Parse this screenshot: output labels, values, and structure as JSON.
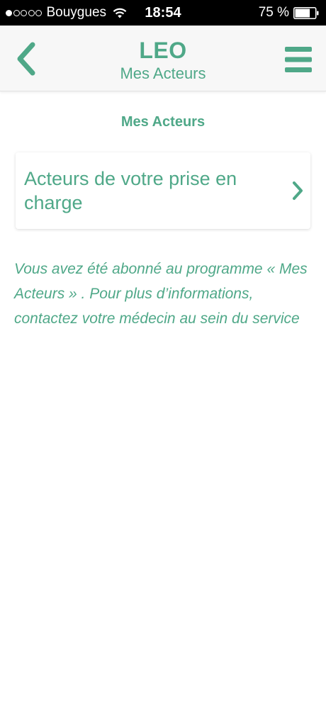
{
  "status_bar": {
    "carrier": "Bouygues",
    "time": "18:54",
    "battery_percent": "75 %",
    "signal_strength": 1,
    "battery_level": 0.75,
    "icons": [
      "signal-dots-icon",
      "wifi-icon",
      "battery-icon"
    ]
  },
  "nav": {
    "title": "LEO",
    "subtitle": "Mes Acteurs",
    "back_icon": "chevron-left-icon",
    "menu_icon": "hamburger-menu-icon"
  },
  "page": {
    "section_title": "Mes Acteurs",
    "card_label": "Acteurs de votre prise en charge",
    "card_icon": "chevron-right-icon",
    "info_text": "Vous avez été abonné au programme «  Mes Acteurs » . Pour plus d’informations, contactez votre médecin au sein du service"
  },
  "colors": {
    "accent": "#4fa888",
    "nav_background": "#f7f7f7",
    "status_background": "#000000",
    "page_background": "#ffffff"
  }
}
